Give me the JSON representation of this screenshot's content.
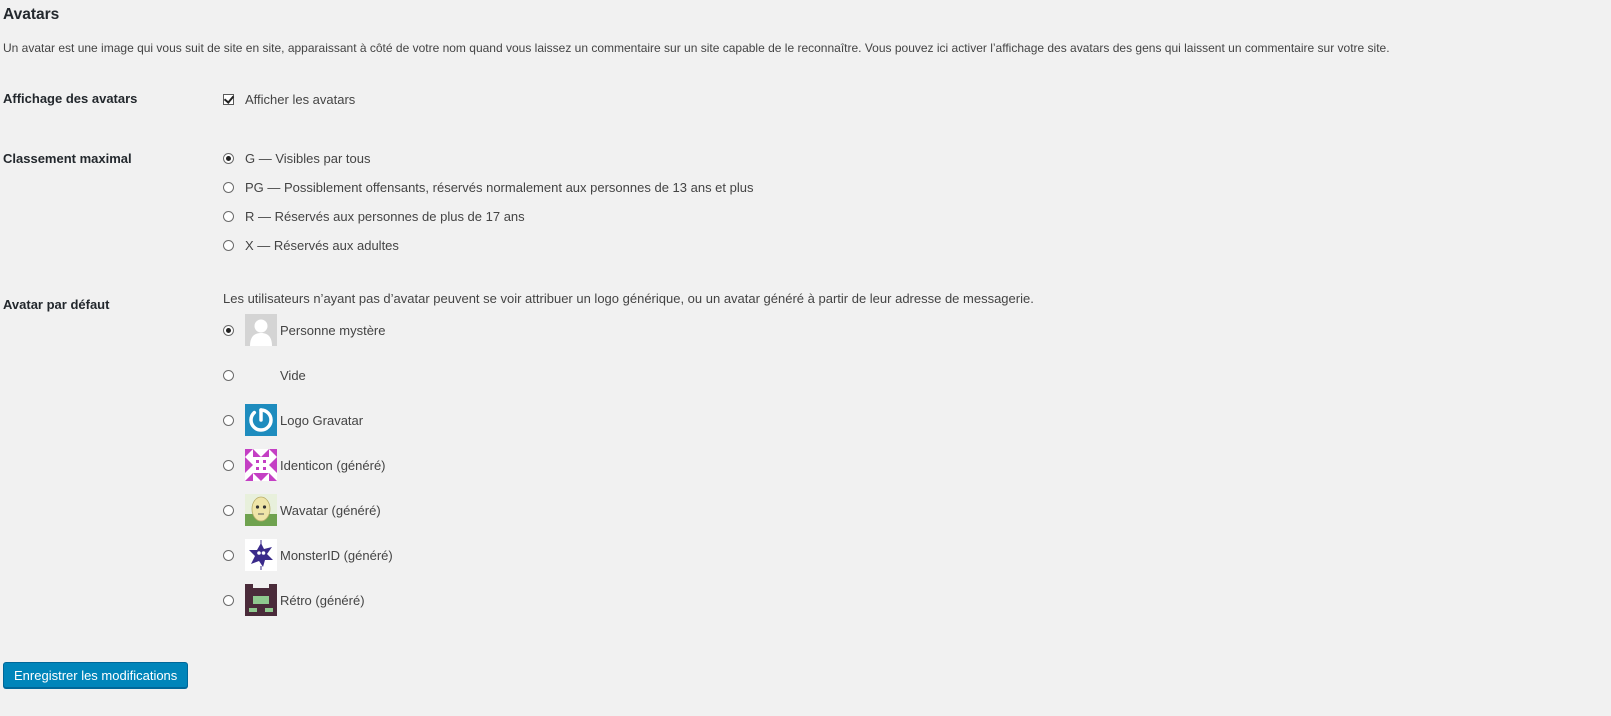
{
  "section": {
    "title": "Avatars",
    "description": "Un avatar est une image qui vous suit de site en site, apparaissant à côté de votre nom quand vous laissez un commentaire sur un site capable de le reconnaître. Vous pouvez ici activer l’affichage des avatars des gens qui laissent un commentaire sur votre site."
  },
  "show_avatars": {
    "label": "Affichage des avatars",
    "checkbox_label": "Afficher les avatars",
    "checked": true
  },
  "rating": {
    "label": "Classement maximal",
    "selected": "G",
    "options": [
      {
        "value": "G",
        "label": "G — Visibles par tous"
      },
      {
        "value": "PG",
        "label": "PG — Possiblement offensants, réservés normalement aux personnes de 13 ans et plus"
      },
      {
        "value": "R",
        "label": "R — Réservés aux personnes de plus de 17 ans"
      },
      {
        "value": "X",
        "label": "X — Réservés aux adultes"
      }
    ]
  },
  "default_avatar": {
    "label": "Avatar par défaut",
    "help": "Les utilisateurs n’ayant pas d’avatar peuvent se voir attribuer un logo générique, ou un avatar généré à partir de leur adresse de messagerie.",
    "selected": "mystery",
    "options": [
      {
        "value": "mystery",
        "label": "Personne mystère",
        "icon": "mystery-person-icon"
      },
      {
        "value": "blank",
        "label": "Vide",
        "icon": "blank"
      },
      {
        "value": "gravatar",
        "label": "Logo Gravatar",
        "icon": "gravatar-logo-icon"
      },
      {
        "value": "identicon",
        "label": "Identicon (généré)",
        "icon": "identicon-icon"
      },
      {
        "value": "wavatar",
        "label": "Wavatar (généré)",
        "icon": "wavatar-icon"
      },
      {
        "value": "monsterid",
        "label": "MonsterID (généré)",
        "icon": "monsterid-icon"
      },
      {
        "value": "retro",
        "label": "Rétro (généré)",
        "icon": "retro-icon"
      }
    ]
  },
  "save_button": {
    "label": "Enregistrer les modifications"
  },
  "colors": {
    "background": "#f1f1f1",
    "primary_button": "#0085ba",
    "gravatar_blue": "#1e8cbe",
    "identicon_magenta": "#c43fc4",
    "monster_purple": "#3a2a8a",
    "retro_dark": "#4a2b3a"
  }
}
